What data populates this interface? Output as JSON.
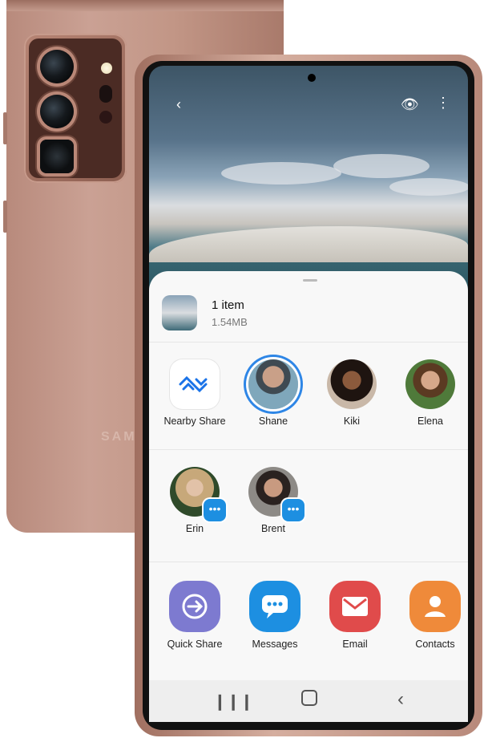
{
  "back_phone": {
    "brand": "SAMS"
  },
  "share_sheet": {
    "item": {
      "count_label": "1 item",
      "size": "1.54MB"
    },
    "contacts_row1": [
      {
        "name": "Nearby Share",
        "icon": "nearby-share-icon"
      },
      {
        "name": "Shane"
      },
      {
        "name": "Kiki"
      },
      {
        "name": "Elena"
      }
    ],
    "contacts_row2": [
      {
        "name": "Erin",
        "badge": "messages-badge-icon"
      },
      {
        "name": "Brent",
        "badge": "messages-badge-icon"
      }
    ],
    "apps": [
      {
        "name": "Quick Share",
        "color": "#7d7ad0",
        "icon": "quick-share-icon"
      },
      {
        "name": "Messages",
        "color": "#1d8fe1",
        "icon": "messages-icon"
      },
      {
        "name": "Email",
        "color": "#e04b4b",
        "icon": "email-icon"
      },
      {
        "name": "Contacts",
        "color": "#ef8a3a",
        "icon": "contacts-icon"
      }
    ]
  },
  "colors": {
    "accent_ring": "#2e86e6",
    "sheet_bg": "#f8f8f8"
  }
}
